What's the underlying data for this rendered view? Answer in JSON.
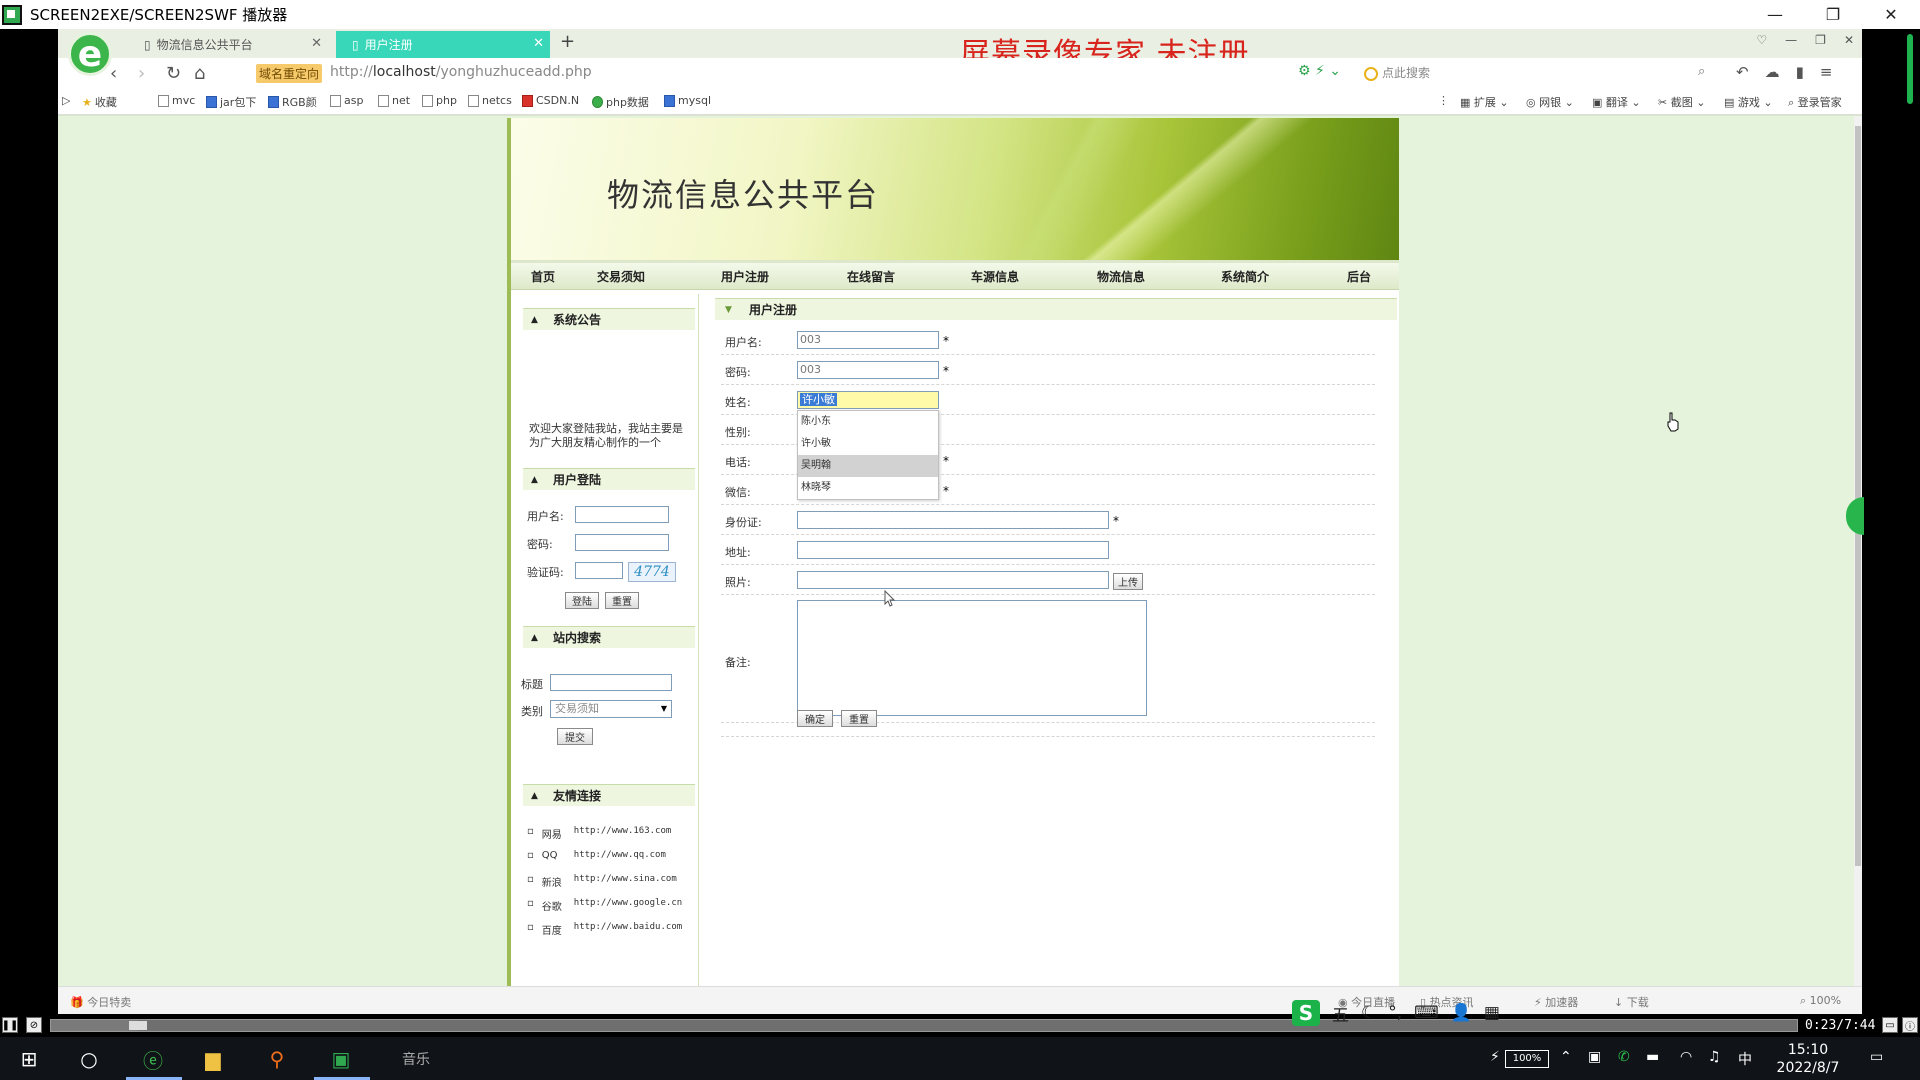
{
  "player": {
    "title": "SCREEN2EXE/SCREEN2SWF 播放器",
    "time": "0:23/7:44"
  },
  "browser": {
    "tabs": [
      {
        "label": "物流信息公共平台"
      },
      {
        "label": "用户注册"
      }
    ],
    "overlay": "屏幕录像专家  未注册",
    "redirect_badge": "域名重定向",
    "url_prefix": "http://",
    "url_host": "localhost",
    "url_path": "/yonghuzhuceadd.php",
    "search_placeholder": "点此搜索",
    "bookmarks": [
      "收藏",
      "mvc",
      "jar包下",
      "RGB颜",
      "asp",
      "net",
      "php",
      "netcs",
      "CSDN.N",
      "php数据",
      "mysql"
    ],
    "toolbar_right": [
      "扩展",
      "网银",
      "翻译",
      "截图",
      "游戏",
      "登录管家"
    ],
    "status_left": "今日特卖",
    "status_right": [
      "今日直播",
      "热点资讯",
      "加速器",
      "下载",
      "100%"
    ]
  },
  "site": {
    "title": "物流信息公共平台",
    "menu": [
      "首页",
      "交易须知",
      "用户注册",
      "在线留言",
      "车源信息",
      "物流信息",
      "系统简介",
      "后台"
    ],
    "sidebar": {
      "notice_head": "系统公告",
      "notice_text": "欢迎大家登陆我站，我站主要是为广大朋友精心制作的一个",
      "login_head": "用户登陆",
      "login_user_label": "用户名:",
      "login_pass_label": "密码:",
      "captcha_label": "验证码:",
      "captcha": "4774",
      "login_btn": "登陆",
      "reset_btn": "重置",
      "search_head": "站内搜索",
      "search_title_label": "标题",
      "search_type_label": "类别",
      "search_type_value": "交易须知",
      "submit_btn": "提交",
      "links_head": "友情连接",
      "links": [
        {
          "name": "网易",
          "url": "http://www.163.com"
        },
        {
          "name": "QQ",
          "url": "http://www.qq.com"
        },
        {
          "name": "新浪",
          "url": "http://www.sina.com"
        },
        {
          "name": "谷歌",
          "url": "http://www.google.cn"
        },
        {
          "name": "百度",
          "url": "http://www.baidu.com"
        }
      ]
    },
    "form": {
      "head": "用户注册",
      "username_label": "用户名:",
      "username_value": "003",
      "password_label": "密码:",
      "password_value": "003",
      "name_label": "姓名:",
      "name_value": "许小敏",
      "gender_label": "性别:",
      "phone_label": "电话:",
      "wechat_label": "微信:",
      "idcard_label": "身份证:",
      "address_label": "地址:",
      "photo_label": "照片:",
      "upload_btn": "上传",
      "remark_label": "备注:",
      "confirm_btn": "确定",
      "reset_btn": "重置",
      "required_mark": "*",
      "autocomplete": [
        "陈小东",
        "许小敏",
        "吴明翰",
        "林晓琴"
      ]
    }
  },
  "taskbar": {
    "music_label": "音乐",
    "battery": "100%",
    "ime_lang": "中",
    "time": "15:10",
    "date": "2022/8/7"
  },
  "ime": {
    "mode": "五"
  }
}
